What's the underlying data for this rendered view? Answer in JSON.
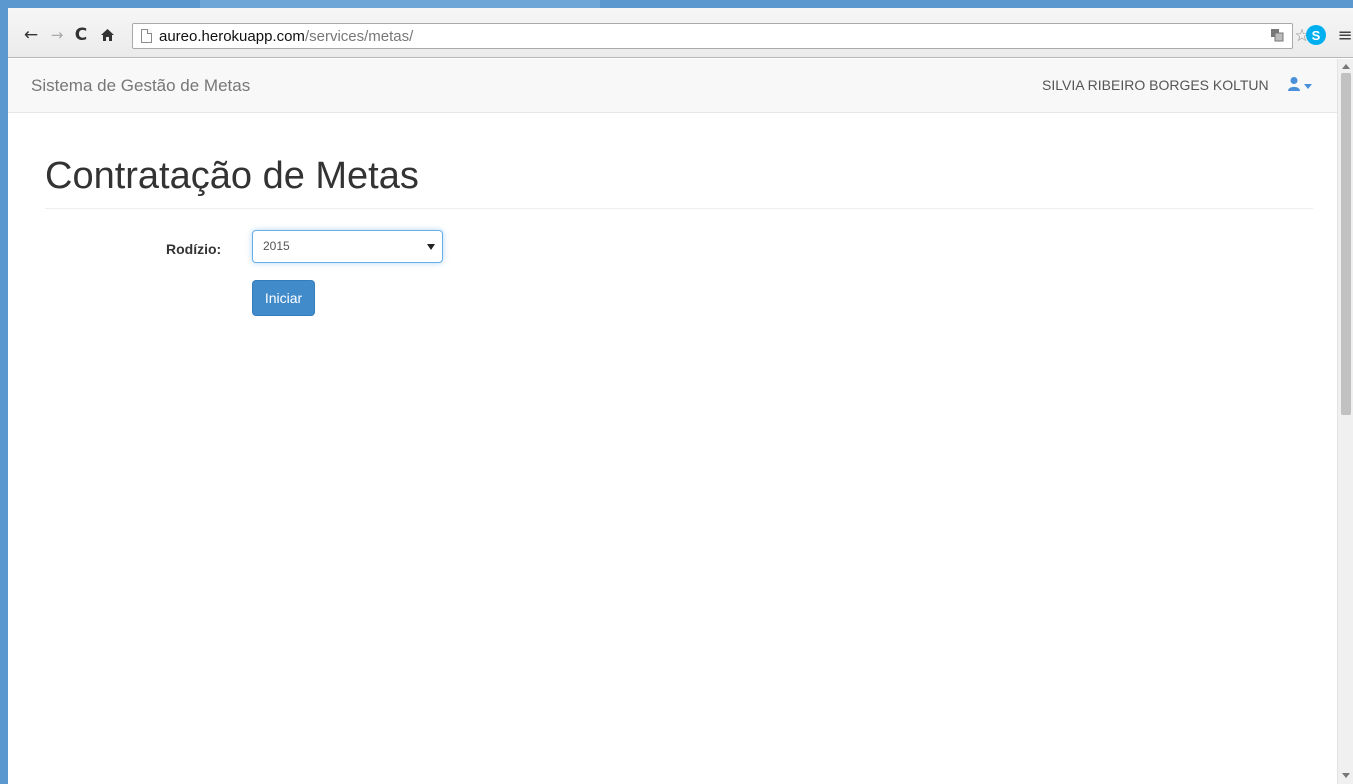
{
  "browser": {
    "url_host": "aureo.herokuapp.com",
    "url_path": "/services/metas/",
    "skype_label": "S"
  },
  "navbar": {
    "brand": "Sistema de Gestão de Metas",
    "user_name": "SILVIA RIBEIRO BORGES KOLTUN"
  },
  "page": {
    "title": "Contratação de Metas"
  },
  "form": {
    "rodizio_label": "Rodízio:",
    "rodizio_selected": "2015",
    "submit_label": "Iniciar"
  },
  "colors": {
    "window_border": "#5b98cf",
    "primary_button": "#428bca",
    "select_focus": "#66afe9"
  },
  "icons": {
    "back": "back-arrow-icon",
    "forward": "forward-arrow-icon",
    "reload": "reload-icon",
    "home": "home-icon",
    "page": "page-icon",
    "translate": "translate-icon",
    "bookmark": "star-icon",
    "skype": "skype-icon",
    "menu": "menu-icon",
    "user": "user-icon"
  }
}
